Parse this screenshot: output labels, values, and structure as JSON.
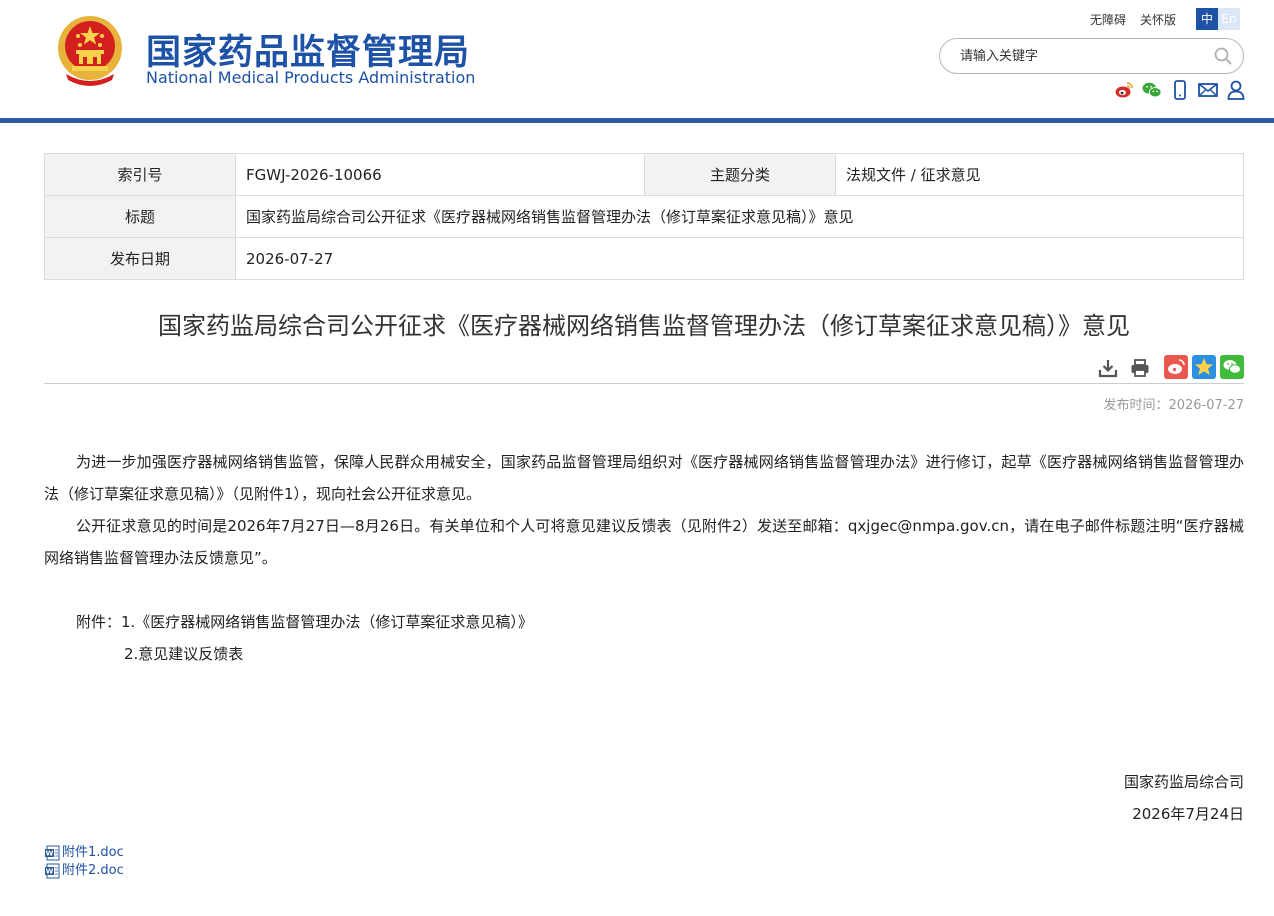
{
  "header": {
    "title_cn": "国家药品监督管理局",
    "title_en": "National Medical Products Administration",
    "links": {
      "accessibility": "无障碍",
      "elderly": "关怀版"
    },
    "lang": {
      "zh": "中",
      "en": "En"
    },
    "search_placeholder": "请输入关键字",
    "social_icons": [
      "weibo-icon",
      "wechat-icon",
      "mobile-icon",
      "mail-icon",
      "user-icon"
    ]
  },
  "meta": {
    "index_label": "索引号",
    "index_value": "FGWJ-2026-10066",
    "category_label": "主题分类",
    "category_value": "法规文件 / 征求意见",
    "title_label": "标题",
    "title_value": "国家药监局综合司公开征求《医疗器械网络销售监督管理办法（修订草案征求意见稿）》意见",
    "date_label": "发布日期",
    "date_value": "2026-07-27"
  },
  "article": {
    "title": "国家药监局综合司公开征求《医疗器械网络销售监督管理办法（修订草案征求意见稿）》意见",
    "pubtime": "发布时间：2026-07-27",
    "paragraphs": [
      "为进一步加强医疗器械网络销售监管，保障人民群众用械安全，国家药品监督管理局组织对《医疗器械网络销售监督管理办法》进行修订，起草《医疗器械网络销售监督管理办法（修订草案征求意见稿）》（见附件1），现向社会公开征求意见。",
      "公开征求意见的时间是2026年7月27日—8月26日。有关单位和个人可将意见建议反馈表（见附件2）发送至邮箱：qxjgec@nmpa.gov.cn，请在电子邮件标题注明“医疗器械网络销售监督管理办法反馈意见”。"
    ],
    "attachments_line1": "附件：1.《医疗器械网络销售监督管理办法（修订草案征求意见稿）》",
    "attachments_line2": "2.意见建议反馈表",
    "signer": "国家药监局综合司",
    "sign_date": "2026年7月24日",
    "files": [
      "附件1.doc",
      "附件2.doc"
    ]
  },
  "colors": {
    "brand": "#1d52a6",
    "rule": "#2a5cab"
  }
}
